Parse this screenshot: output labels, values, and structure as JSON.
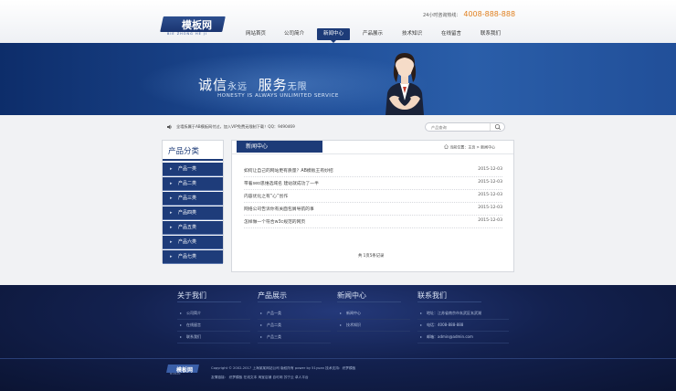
{
  "logo": {
    "text": "模板网",
    "subtext": "BIE ZHONG HE JI"
  },
  "hotline": {
    "label": "24小时咨询热线：",
    "number": "4008-888-888"
  },
  "nav": {
    "items": [
      "网站首页",
      "公司简介",
      "新闻中心",
      "产品展示",
      "技术知识",
      "在线留言",
      "联系我们"
    ],
    "active_index": 2
  },
  "banner": {
    "slogan_a": "诚信",
    "slogan_a_small": "永远",
    "slogan_b": "服务",
    "slogan_b_small": "无限",
    "slogan_en": "HONESTY IS ALWAYS UNLIMITED SERVICE"
  },
  "notice": {
    "text": "全墙拆属于AB模板网付过，加入VIP免费无限制下载！QQ：9490469"
  },
  "search": {
    "placeholder": "产品查询"
  },
  "sidebar": {
    "title": "产品分类",
    "items": [
      "产品一类",
      "产品二类",
      "产品三类",
      "产品四类",
      "产品五类",
      "产品六类",
      "产品七类"
    ]
  },
  "main": {
    "tab": "新闻中心",
    "breadcrumb": "当前位置：主页 > 新闻中心",
    "news": [
      {
        "title": "如何让自己的网站更有质量？AB模板王有妙招",
        "date": "2015-12-03"
      },
      {
        "title": "带着seo思维选域名 建站就成功了一半",
        "date": "2015-12-03"
      },
      {
        "title": "内容优化之有“心”创作",
        "date": "2015-12-03"
      },
      {
        "title": "网络公司告诉你有关面包屑导航的事",
        "date": "2015-12-03"
      },
      {
        "title": "怎样做一个符合w3c规范的网页",
        "date": "2015-12-03"
      }
    ],
    "pager": "共 1页5条记录"
  },
  "footer": {
    "columns": [
      {
        "title": "关于我们",
        "items": [
          "公司简介",
          "在线留言",
          "联系我们"
        ]
      },
      {
        "title": "产品展示",
        "items": [
          "产品一类",
          "产品二类",
          "产品三类"
        ]
      },
      {
        "title": "新闻中心",
        "items": [
          "新闻中心",
          "技术知识"
        ]
      },
      {
        "title": "联系我们",
        "items": [
          "地址：江苏省南京市玄武区玄武湖",
          "电话：4008-888-888",
          "邮箱：admin@admin.com"
        ]
      }
    ],
    "logo_text": "模板网",
    "logo_sub": "MOBAN",
    "copyright": "Copyright © 2002-2017 上海某某网站公司 版权所有 power by 51yuan 技术支持：织梦模板",
    "links": "友情链接：  织梦模板  在线文本  淘宝店铺  自可网  苏宁云  卓人平台"
  },
  "colors": {
    "primary": "#1d3b78",
    "accent": "#e08020",
    "footer_bg": "#13214f"
  }
}
